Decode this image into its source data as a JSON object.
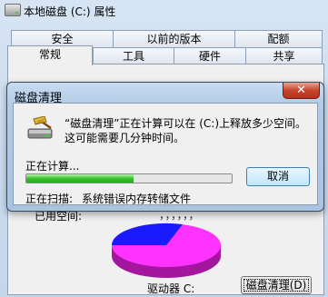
{
  "background_window": {
    "title": "本地磁盘 (C:) 属性",
    "tabs_top": [
      "安全",
      "以前的版本",
      "配额"
    ],
    "tabs_bottom": [
      "常规",
      "工具",
      "硬件",
      "共享"
    ],
    "used_label_fragment": "已用空间:",
    "used_value_fragment": "，，，，，，",
    "drive_label": "驱动器 C:",
    "cleanup_button": "磁盘清理(D)"
  },
  "pie": {
    "used_color": "#ff33ff",
    "free_color": "#1a1aff"
  },
  "dialog": {
    "title": "磁盘清理",
    "close_symbol": "✕",
    "message": "“磁盘清理”正在计算可以在 (C:)上释放多少空间。这可能需要几分钟时间。",
    "calculating_label": "正在计算...",
    "progress_percent": 52,
    "cancel_button": "取消",
    "scanning_label": "正在扫描:",
    "scanning_item": "系统错误内存转储文件"
  },
  "colors": {
    "dialog_frame": "#a9c3e2",
    "progress_green": "#37c42a",
    "close_red": "#c7432c"
  }
}
